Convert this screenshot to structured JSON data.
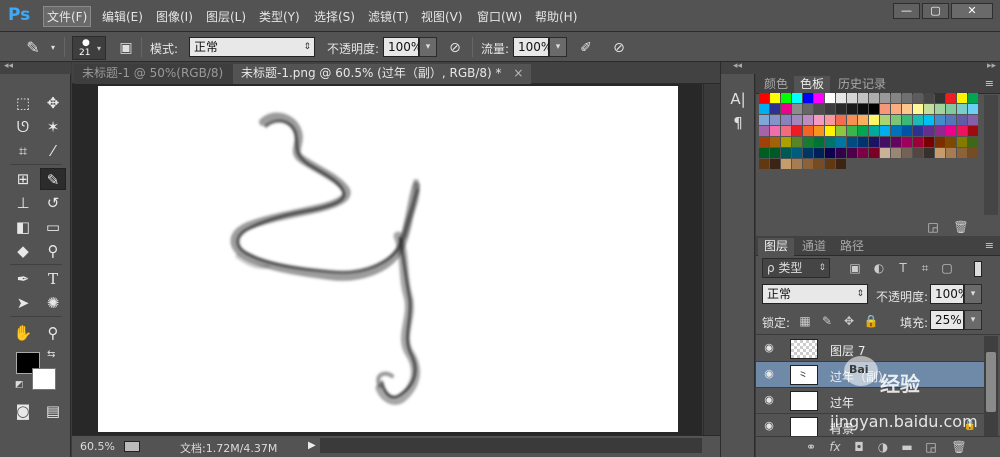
{
  "app": {
    "logo": "Ps"
  },
  "menu": [
    "文件(F)",
    "编辑(E)",
    "图像(I)",
    "图层(L)",
    "类型(Y)",
    "选择(S)",
    "滤镜(T)",
    "视图(V)",
    "窗口(W)",
    "帮助(H)"
  ],
  "window_controls": {
    "minimize": "—",
    "restore": "▢",
    "close": "✕"
  },
  "options": {
    "brush_size": "21",
    "mode_label": "模式:",
    "mode_value": "正常",
    "opacity_label": "不透明度:",
    "opacity_value": "100%",
    "flow_label": "流量:",
    "flow_value": "100%"
  },
  "tabs": [
    {
      "label": "未标题-1 @ 50%(RGB/8)",
      "active": false
    },
    {
      "label": "未标题-1.png @ 60.5% (过年（副）, RGB/8) *",
      "active": true
    }
  ],
  "status": {
    "zoom": "60.5%",
    "doc_info": "文档:1.72M/4.37M"
  },
  "mini_panel": [
    "A|",
    "¶"
  ],
  "swatch_panel": {
    "tabs": [
      "颜色",
      "色板",
      "历史记录"
    ],
    "active_tab": "色板"
  },
  "swatch_rows": [
    [
      "#ff0000",
      "#ffff00",
      "#00ff00",
      "#00ffff",
      "#0000ff",
      "#ff00ff",
      "#ffffff",
      "#e6e6e6",
      "#d6d6d6",
      "#c2c2c2",
      "#adadad",
      "#999999",
      "#858585",
      "#707070",
      "#5c5c5c",
      "#474747",
      "#333333",
      "#ee1d24",
      "#fff200",
      "#00a651"
    ],
    [
      "#00aeef",
      "#2e3192",
      "#ec008c",
      "#8c8c8c",
      "#666666",
      "#4d4d4d",
      "#3d3d3d",
      "#292929",
      "#1a1a1a",
      "#0d0d0d",
      "#000000",
      "#f7977a",
      "#f9ad81",
      "#fdc68a",
      "#fff79a",
      "#c4df9b",
      "#a3d39c",
      "#82ca9d",
      "#7bcdc8",
      "#6ecff6"
    ],
    [
      "#7ea7d8",
      "#8493ca",
      "#8882be",
      "#a187be",
      "#bc8dbf",
      "#f49ac2",
      "#f6989d",
      "#f26c4f",
      "#f68e55",
      "#fbaf5c",
      "#fff467",
      "#acd372",
      "#7cc576",
      "#3bb878",
      "#1abbb4",
      "#00bff3",
      "#438ccb",
      "#5574b9",
      "#605ca8",
      "#855fa8"
    ],
    [
      "#a763a8",
      "#f06eaa",
      "#f16d7e",
      "#ed1c24",
      "#f26522",
      "#f7941d",
      "#fff200",
      "#8dc73f",
      "#39b54a",
      "#00a651",
      "#00a99d",
      "#00aeef",
      "#0072bc",
      "#0054a6",
      "#2e3192",
      "#662d91",
      "#92278f",
      "#ec008c",
      "#ed145b",
      "#9e0b0f"
    ],
    [
      "#a0410d",
      "#a3620a",
      "#aba000",
      "#598527",
      "#197b30",
      "#007236",
      "#00746b",
      "#0076a3",
      "#004b80",
      "#003471",
      "#1b1464",
      "#440e62",
      "#630460",
      "#9e005d",
      "#9e0039",
      "#790000",
      "#7b2e00",
      "#7d4900",
      "#827b00",
      "#406618"
    ],
    [
      "#005e20",
      "#005826",
      "#005952",
      "#005b7f",
      "#003663",
      "#002157",
      "#0d004c",
      "#32004b",
      "#4b0049",
      "#7b0046",
      "#7a0026",
      "#c7b299",
      "#998675",
      "#736357",
      "#534741",
      "#37302d",
      "#c69c6d",
      "#a67c52",
      "#8c6239",
      "#754c24"
    ],
    [
      "#603913",
      "#3c2415",
      "#c69c6d",
      "#a67c52",
      "#8c6239",
      "#754c24",
      "#603913",
      "#3c2415"
    ]
  ],
  "layers_panel": {
    "tabs": [
      "图层",
      "通道",
      "路径"
    ],
    "active_tab": "图层",
    "filter_label": "ρ 类型",
    "blend_mode": "正常",
    "opacity_label": "不透明度:",
    "opacity_value": "100%",
    "lock_label": "锁定:",
    "fill_label": "填充:",
    "fill_value": "25%",
    "layers": [
      {
        "name": "图层 7",
        "selected": false,
        "thumb": "transparent"
      },
      {
        "name": "过年（副）",
        "selected": true,
        "thumb": "brush"
      },
      {
        "name": "过年",
        "selected": false,
        "thumb": "white"
      },
      {
        "name": "背景",
        "selected": false,
        "thumb": "white",
        "locked": true
      }
    ]
  },
  "footer_icons": [
    "link-icon",
    "fx-icon",
    "mask-icon",
    "adjustment-icon",
    "folder-icon",
    "new-layer-icon",
    "trash-icon"
  ],
  "watermark": {
    "brand": "经验",
    "url": "jingyan.baidu.com",
    "logo": "Bai"
  }
}
